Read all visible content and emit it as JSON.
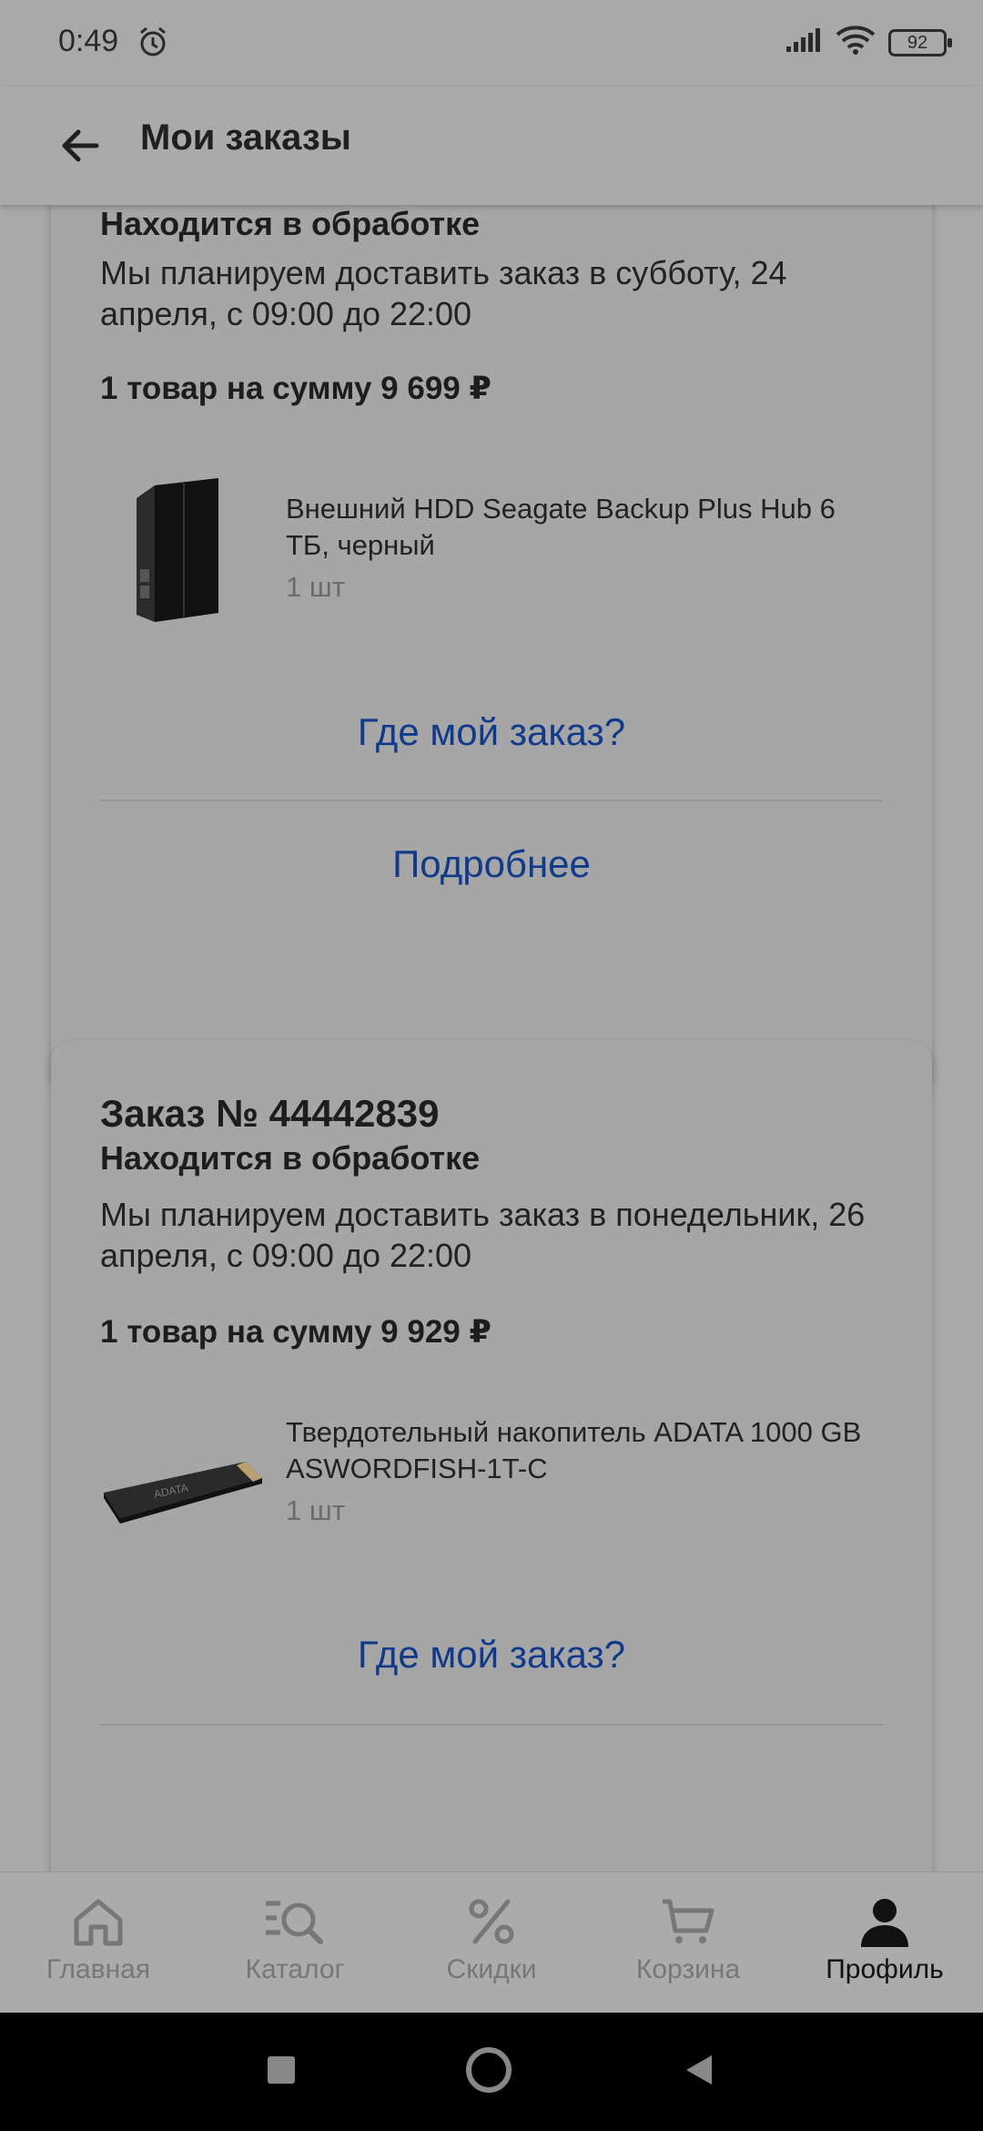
{
  "status_bar": {
    "time": "0:49",
    "battery": "92"
  },
  "app_bar": {
    "title": "Мои заказы"
  },
  "orders": [
    {
      "number": "",
      "status": "Находится в обработке",
      "delivery": "Мы планируем доставить заказ в субботу, 24 апреля, с 09:00 до 22:00",
      "summary": "1 товар на сумму 9 699 ₽",
      "product_name": "Внешний HDD Seagate Backup Plus Hub 6 ТБ, черный",
      "product_qty": "1 шт",
      "where_link": "Где мой заказ?",
      "details_link": "Подробнее"
    },
    {
      "number": "Заказ № 44442839",
      "status": "Находится в обработке",
      "delivery": "Мы планируем доставить заказ в понедельник, 26 апреля, с 09:00 до 22:00",
      "summary": "1 товар на сумму 9 929 ₽",
      "product_name": "Твердотельный накопитель ADATA 1000 GB ASWORDFISH-1T-C",
      "product_qty": "1 шт",
      "where_link": "Где мой заказ?"
    }
  ],
  "bottom_nav": [
    {
      "label": "Главная",
      "icon": "home-icon"
    },
    {
      "label": "Каталог",
      "icon": "catalog-search-icon"
    },
    {
      "label": "Скидки",
      "icon": "percent-icon"
    },
    {
      "label": "Корзина",
      "icon": "cart-icon"
    },
    {
      "label": "Профиль",
      "icon": "profile-icon",
      "active": true
    }
  ]
}
